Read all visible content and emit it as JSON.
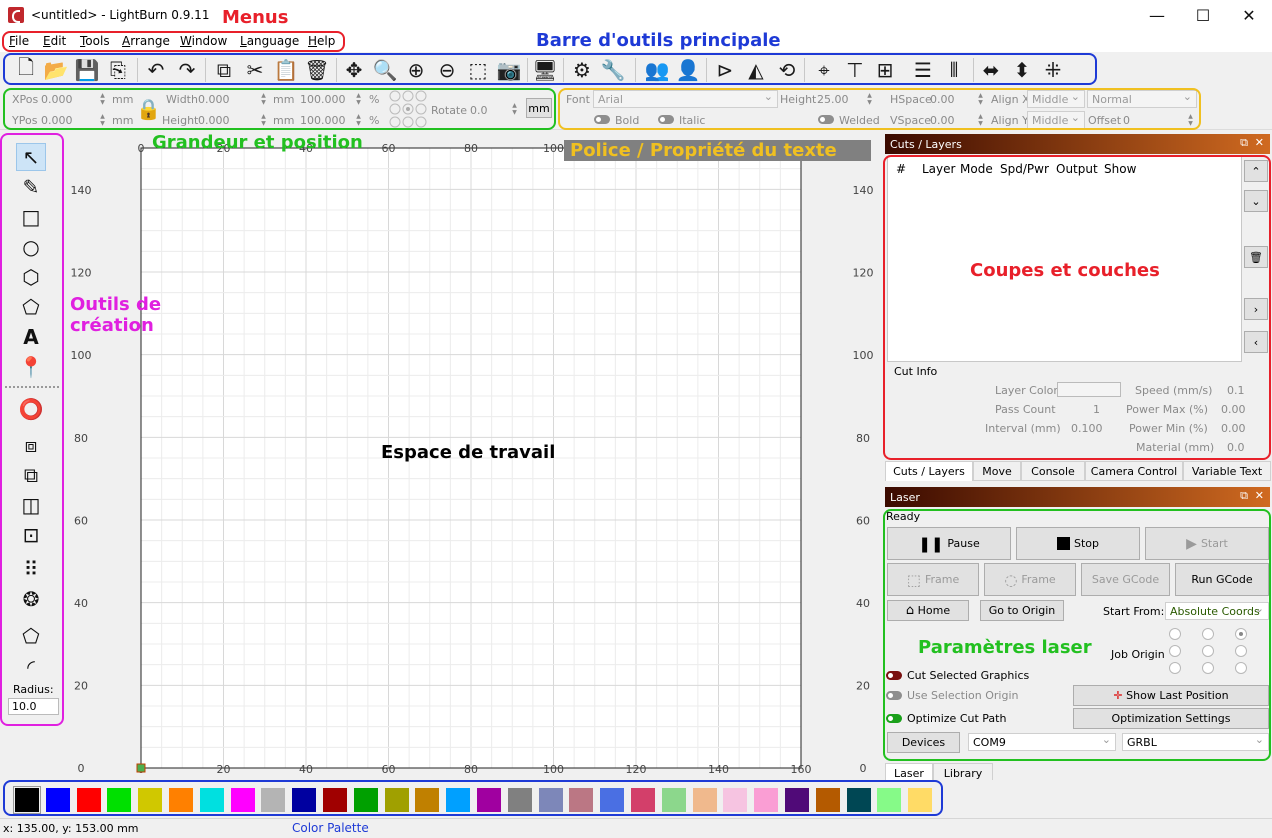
{
  "window": {
    "title": "<untitled> - LightBurn 0.9.11",
    "min": "—",
    "max": "☐",
    "close": "✕"
  },
  "menu": [
    "File",
    "Edit",
    "Tools",
    "Arrange",
    "Window",
    "Language",
    "Help"
  ],
  "props": {
    "xpos_label": "XPos",
    "xpos": "0.000",
    "ypos_label": "YPos",
    "ypos": "0.000",
    "width_label": "Width",
    "width": "0.000",
    "height_label": "Height",
    "height": "0.000",
    "unit": "mm",
    "scale_x": "100.000",
    "scale_y": "100.000",
    "pct": "%",
    "rotate_label": "Rotate",
    "rotate": "0.0",
    "mm_button": "mm"
  },
  "text_props": {
    "font_label": "Font",
    "font": "Arial",
    "height_label": "Height",
    "height": "25.00",
    "hspace_label": "HSpace",
    "hspace": "0.00",
    "vspace_label": "VSpace",
    "vspace": "0.00",
    "alignx_label": "Align X",
    "alignx": "Middle",
    "aligny_label": "Align Y",
    "aligny": "Middle",
    "style": "Normal",
    "offset_label": "Offset",
    "offset": "0",
    "bold": "Bold",
    "italic": "Italic",
    "welded": "Welded"
  },
  "tools": {
    "radius_label": "Radius:",
    "radius": "10.0"
  },
  "canvas": {
    "x_ticks": [
      "0",
      "20",
      "40",
      "60",
      "80",
      "100",
      "120",
      "140",
      "160"
    ],
    "y_ticks": [
      "140",
      "120",
      "100",
      "80",
      "60",
      "40",
      "20",
      "0"
    ]
  },
  "cuts": {
    "title": "Cuts / Layers",
    "columns": [
      "#",
      "Layer",
      "Mode",
      "Spd/Pwr",
      "Output",
      "Show"
    ],
    "cutinfo": "Cut Info",
    "layer_color": "Layer Color",
    "pass_count": "Pass Count",
    "pass_count_val": "1",
    "interval": "Interval (mm)",
    "interval_val": "0.100",
    "speed": "Speed (mm/s)",
    "speed_val": "0.1",
    "pmax": "Power Max (%)",
    "pmax_val": "0.00",
    "pmin": "Power Min (%)",
    "pmin_val": "0.00",
    "material": "Material (mm)",
    "material_val": "0.0"
  },
  "tabs": [
    "Cuts / Layers",
    "Move",
    "Console",
    "Camera Control",
    "Variable Text"
  ],
  "laser": {
    "title": "Laser",
    "status": "Ready",
    "pause": "Pause",
    "stop": "Stop",
    "start": "Start",
    "frame1": "Frame",
    "frame2": "Frame",
    "save_gcode": "Save GCode",
    "run_gcode": "Run GCode",
    "home": "Home",
    "go_origin": "Go to Origin",
    "start_from_label": "Start From:",
    "start_from": "Absolute Coords",
    "job_origin": "Job Origin",
    "cut_selected": "Cut Selected Graphics",
    "use_sel_origin": "Use Selection Origin",
    "optimize": "Optimize Cut Path",
    "show_last": "Show Last Position",
    "opt_settings": "Optimization Settings",
    "devices": "Devices",
    "port": "COM9",
    "controller": "GRBL"
  },
  "bottom_tabs": [
    "Laser",
    "Library"
  ],
  "palette": [
    "#000000",
    "#0000ff",
    "#ff0000",
    "#00e000",
    "#d0c800",
    "#ff8000",
    "#00e0e0",
    "#ff00ff",
    "#b4b4b4",
    "#0000a0",
    "#a00000",
    "#00a000",
    "#a0a000",
    "#c08000",
    "#00a0ff",
    "#a000a0",
    "#808080",
    "#7d87b9",
    "#bb7784",
    "#4a6fe3",
    "#d33f6a",
    "#8cd78c",
    "#f0b98d",
    "#f6c4e1",
    "#fa9ed4",
    "#500a78",
    "#b45a00",
    "#004754",
    "#86fa88",
    "#ffdb66"
  ],
  "status": {
    "coords": "x: 135.00, y: 153.00 mm"
  },
  "annotations": {
    "menus": "Menus",
    "main_toolbar": "Barre d'outils principale",
    "size_pos": "Grandeur et position",
    "font_props": "Police / Propriété du texte",
    "creation_tools": "Outils de création",
    "workspace": "Espace de travail",
    "cuts_layers": "Coupes et couches",
    "laser_params": "Paramètres laser",
    "color_palette": "Color Palette"
  },
  "colors": {
    "red": "#e8202a",
    "blue": "#1e3ad6",
    "green": "#22c020",
    "yellow": "#f0c020",
    "magenta": "#e020e0",
    "gray": "#808080"
  }
}
